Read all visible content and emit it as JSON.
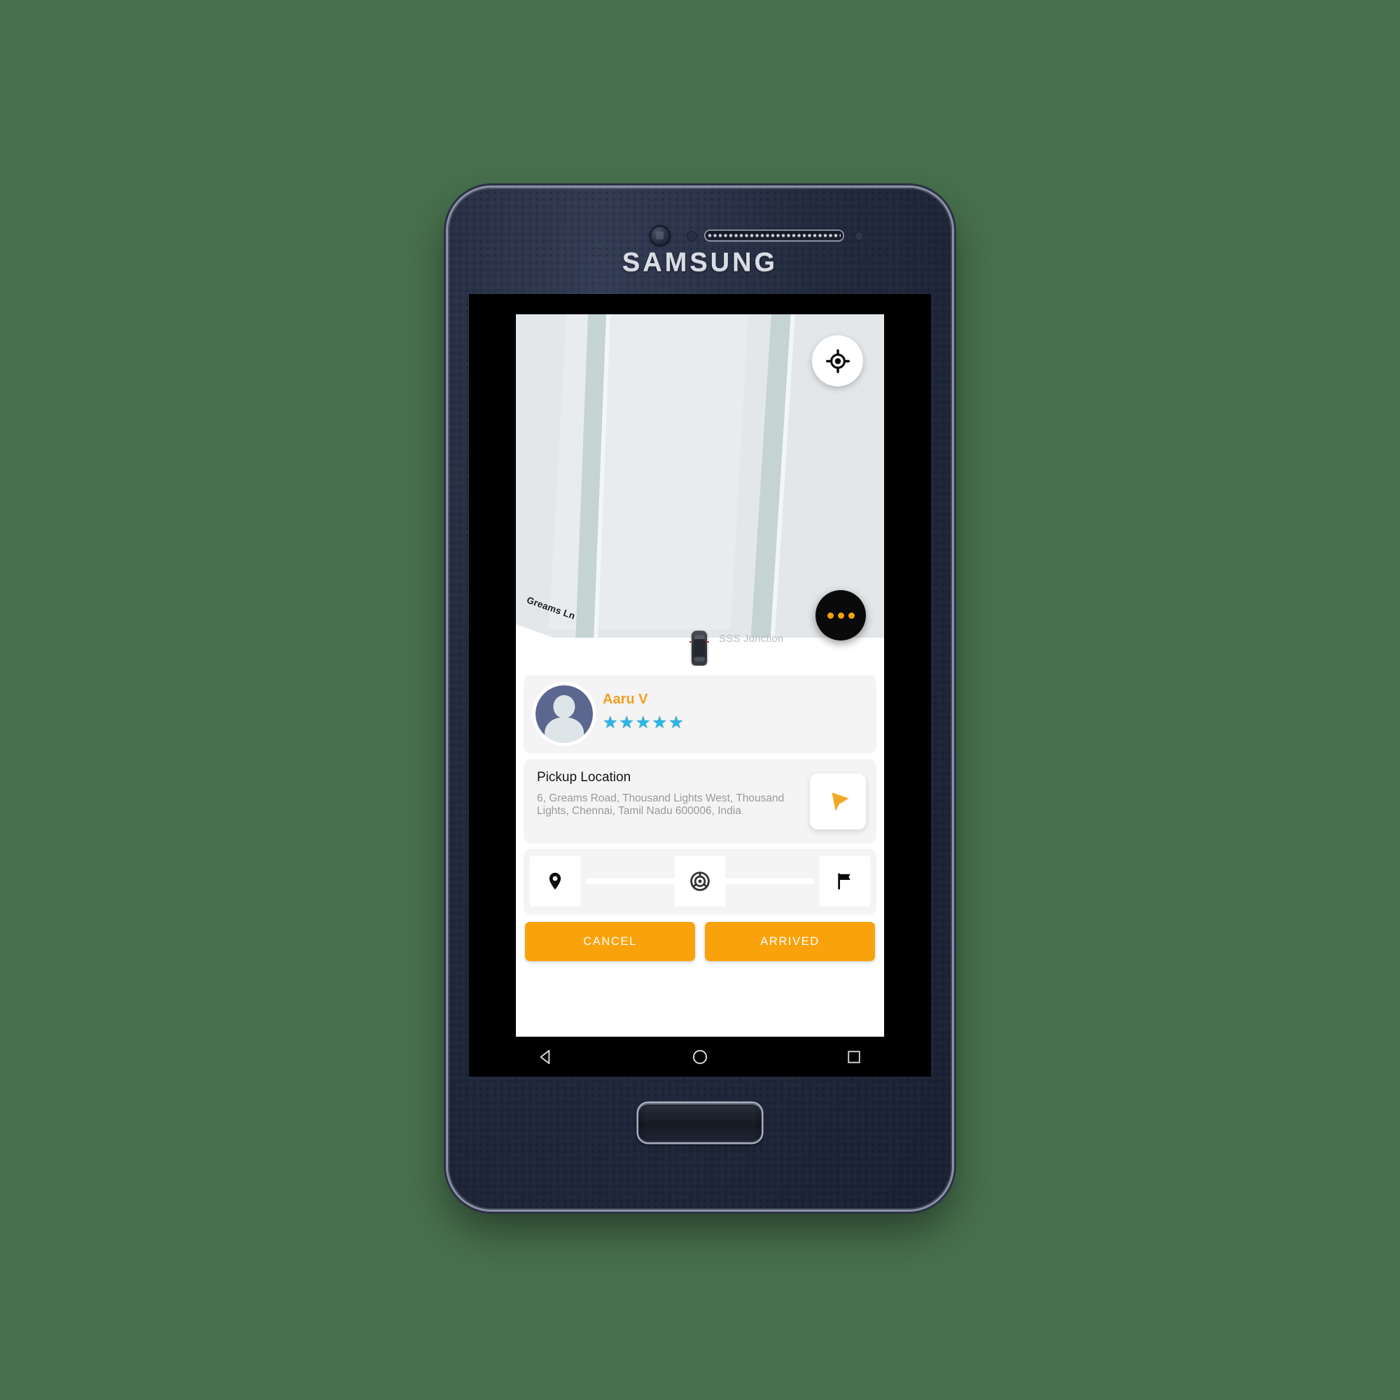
{
  "device": {
    "brand": "SAMSUNG",
    "hardware": {
      "speaker": "speaker-grille",
      "front_camera": "front-camera",
      "home_button": "home-button"
    }
  },
  "map": {
    "street_label": "Greams Ln",
    "place_label": "SSS Junction",
    "locate_button": "my-location",
    "more_button": "more-options",
    "vehicle_marker": "car-marker",
    "colors": {
      "land": "#e3e7e9",
      "block": "#e9ecee",
      "road": "#c6d3d3",
      "street_white": "#ffffff"
    }
  },
  "driver": {
    "name": "Aaru V",
    "rating": 5,
    "rating_max": 5,
    "star_glyph": "★",
    "avatar": "driver-avatar"
  },
  "pickup": {
    "title": "Pickup Location",
    "address": "6, Greams Road, Thousand Lights West, Thousand Lights, Chennai, Tamil Nadu 600006, India",
    "navigate_button": "navigate-arrow"
  },
  "progress": {
    "steps": [
      {
        "name": "pickup",
        "icon": "map-pin-icon"
      },
      {
        "name": "driving",
        "icon": "steering-wheel-icon"
      },
      {
        "name": "destination",
        "icon": "flag-icon"
      }
    ]
  },
  "actions": {
    "cancel_label": "CANCEL",
    "arrived_label": "ARRIVED"
  },
  "navbar": {
    "back": "back-triangle",
    "home": "home-circle",
    "recents": "recents-square"
  },
  "colors": {
    "accent_orange": "#f9a20b",
    "name_orange": "#f0a020",
    "star_blue": "#29b6e8",
    "background_green": "#48704d",
    "card_gray": "#f4f4f4"
  }
}
